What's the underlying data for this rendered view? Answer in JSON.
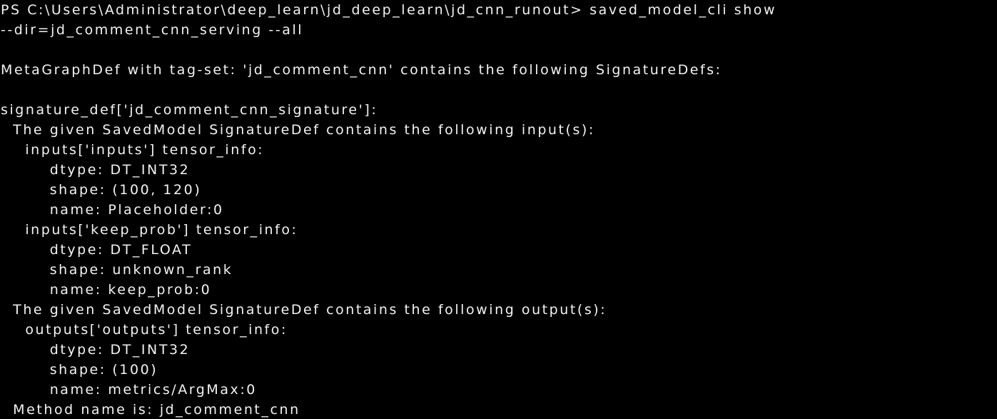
{
  "terminal": {
    "shell": "PowerShell",
    "background_color": "#000000",
    "foreground_color": "#f2f2f2",
    "prompt": "PS C:\\Users\\Administrator\\deep_learn\\jd_deep_learn\\jd_cnn_runout>",
    "command": "saved_model_cli show --dir=jd_comment_cnn_serving --all",
    "lines": [
      "PS C:\\Users\\Administrator\\deep_learn\\jd_deep_learn\\jd_cnn_runout> saved_model_cli show",
      "--dir=jd_comment_cnn_serving --all",
      "",
      "MetaGraphDef with tag-set: 'jd_comment_cnn' contains the following SignatureDefs:",
      "",
      "signature_def['jd_comment_cnn_signature']:",
      "  The given SavedModel SignatureDef contains the following input(s):",
      "    inputs['inputs'] tensor_info:",
      "        dtype: DT_INT32",
      "        shape: (100, 120)",
      "        name: Placeholder:0",
      "    inputs['keep_prob'] tensor_info:",
      "        dtype: DT_FLOAT",
      "        shape: unknown_rank",
      "        name: keep_prob:0",
      "  The given SavedModel SignatureDef contains the following output(s):",
      "    outputs['outputs'] tensor_info:",
      "        dtype: DT_INT32",
      "        shape: (100)",
      "        name: metrics/ArgMax:0",
      "  Method name is: jd_comment_cnn"
    ],
    "details": {
      "tag_set": "jd_comment_cnn",
      "signature_def_key": "jd_comment_cnn_signature",
      "method_name": "jd_comment_cnn",
      "inputs": [
        {
          "key": "inputs",
          "dtype": "DT_INT32",
          "shape": "(100, 120)",
          "name": "Placeholder:0"
        },
        {
          "key": "keep_prob",
          "dtype": "DT_FLOAT",
          "shape": "unknown_rank",
          "name": "keep_prob:0"
        }
      ],
      "outputs": [
        {
          "key": "outputs",
          "dtype": "DT_INT32",
          "shape": "(100)",
          "name": "metrics/ArgMax:0"
        }
      ]
    }
  }
}
